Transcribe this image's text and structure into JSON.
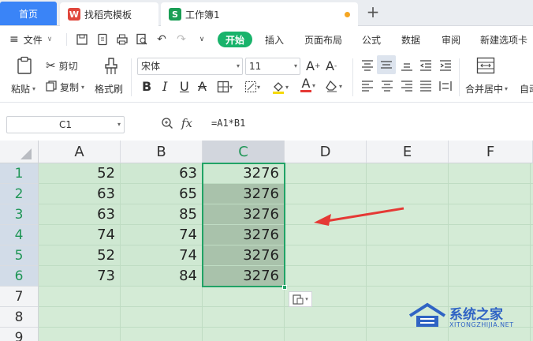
{
  "tabs": {
    "home": "首页",
    "templates": "找稻壳模板",
    "workbook": "工作簿1"
  },
  "menu": {
    "file": "文件",
    "start": "开始",
    "insert": "插入",
    "page_layout": "页面布局",
    "formula": "公式",
    "data": "数据",
    "review": "审阅",
    "new_tab": "新建选项卡"
  },
  "ribbon": {
    "paste": "粘贴",
    "cut": "剪切",
    "copy": "复制",
    "format_painter": "格式刷",
    "font_name": "宋体",
    "font_size": "11",
    "merge": "合并居中",
    "auto": "自动"
  },
  "formula_bar": {
    "name_box": "C1",
    "fx": "fx",
    "formula": "=A1*B1"
  },
  "grid": {
    "columns": [
      "A",
      "B",
      "C",
      "D",
      "E",
      "F"
    ],
    "rows": [
      "1",
      "2",
      "3",
      "4",
      "5",
      "6",
      "7",
      "8",
      "9"
    ],
    "data": [
      [
        "52",
        "63",
        "3276"
      ],
      [
        "63",
        "65",
        "3276"
      ],
      [
        "63",
        "85",
        "3276"
      ],
      [
        "74",
        "74",
        "3276"
      ],
      [
        "52",
        "74",
        "3276"
      ],
      [
        "73",
        "84",
        "3276"
      ]
    ]
  },
  "watermark": {
    "name": "系统之家",
    "url": "XITONGZHIJIA.NET"
  },
  "colors": {
    "accent_green": "#19b36b",
    "selection_border": "#21a366",
    "arrow": "#e53935",
    "tab_blue": "#3a84f7"
  }
}
